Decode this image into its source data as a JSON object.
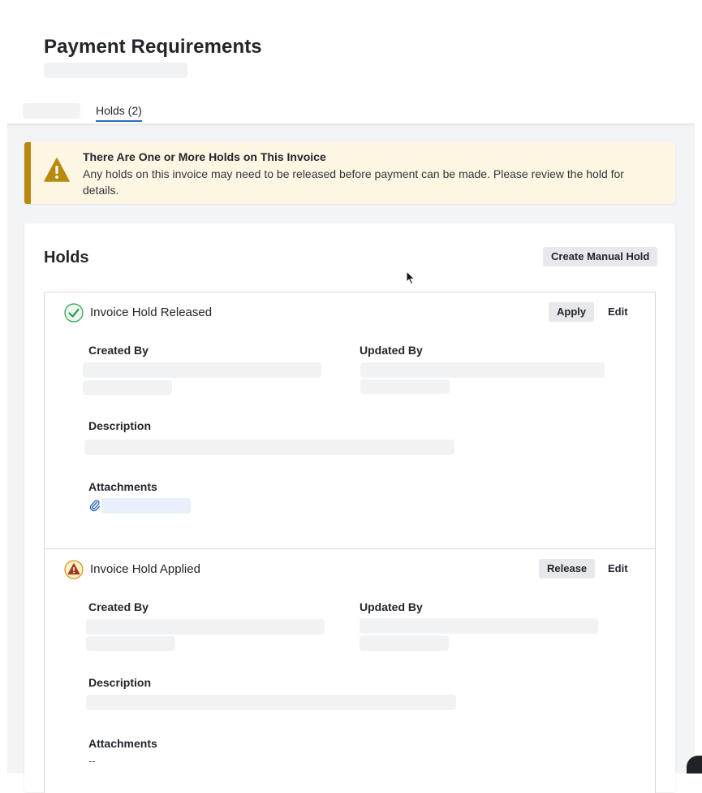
{
  "page": {
    "title": "Payment Requirements"
  },
  "tabs": {
    "holds_label": "Holds (2)"
  },
  "alert": {
    "title": "There Are One or More Holds on This Invoice",
    "body": "Any holds on this invoice may need to be released before payment can be made. Please review the hold for details."
  },
  "holds_section": {
    "heading": "Holds",
    "create_button": "Create Manual Hold",
    "items": [
      {
        "title": "Invoice Hold Released",
        "status": "released",
        "status_icon": "check-circle-icon",
        "action_label": "Apply",
        "edit_label": "Edit",
        "created_by_label": "Created By",
        "updated_by_label": "Updated By",
        "description_label": "Description",
        "attachments_label": "Attachments"
      },
      {
        "title": "Invoice Hold Applied",
        "status": "applied",
        "status_icon": "warning-circle-icon",
        "action_label": "Release",
        "edit_label": "Edit",
        "created_by_label": "Created By",
        "updated_by_label": "Updated By",
        "description_label": "Description",
        "attachments_label": "Attachments",
        "attachments_empty": "--"
      }
    ]
  },
  "colors": {
    "accent_tab": "#2d6ac0",
    "warning_bar": "#b8890a",
    "warning_bg": "#fdf6e3",
    "success": "#2e9e4f",
    "danger_icon": "#a33a1b"
  }
}
